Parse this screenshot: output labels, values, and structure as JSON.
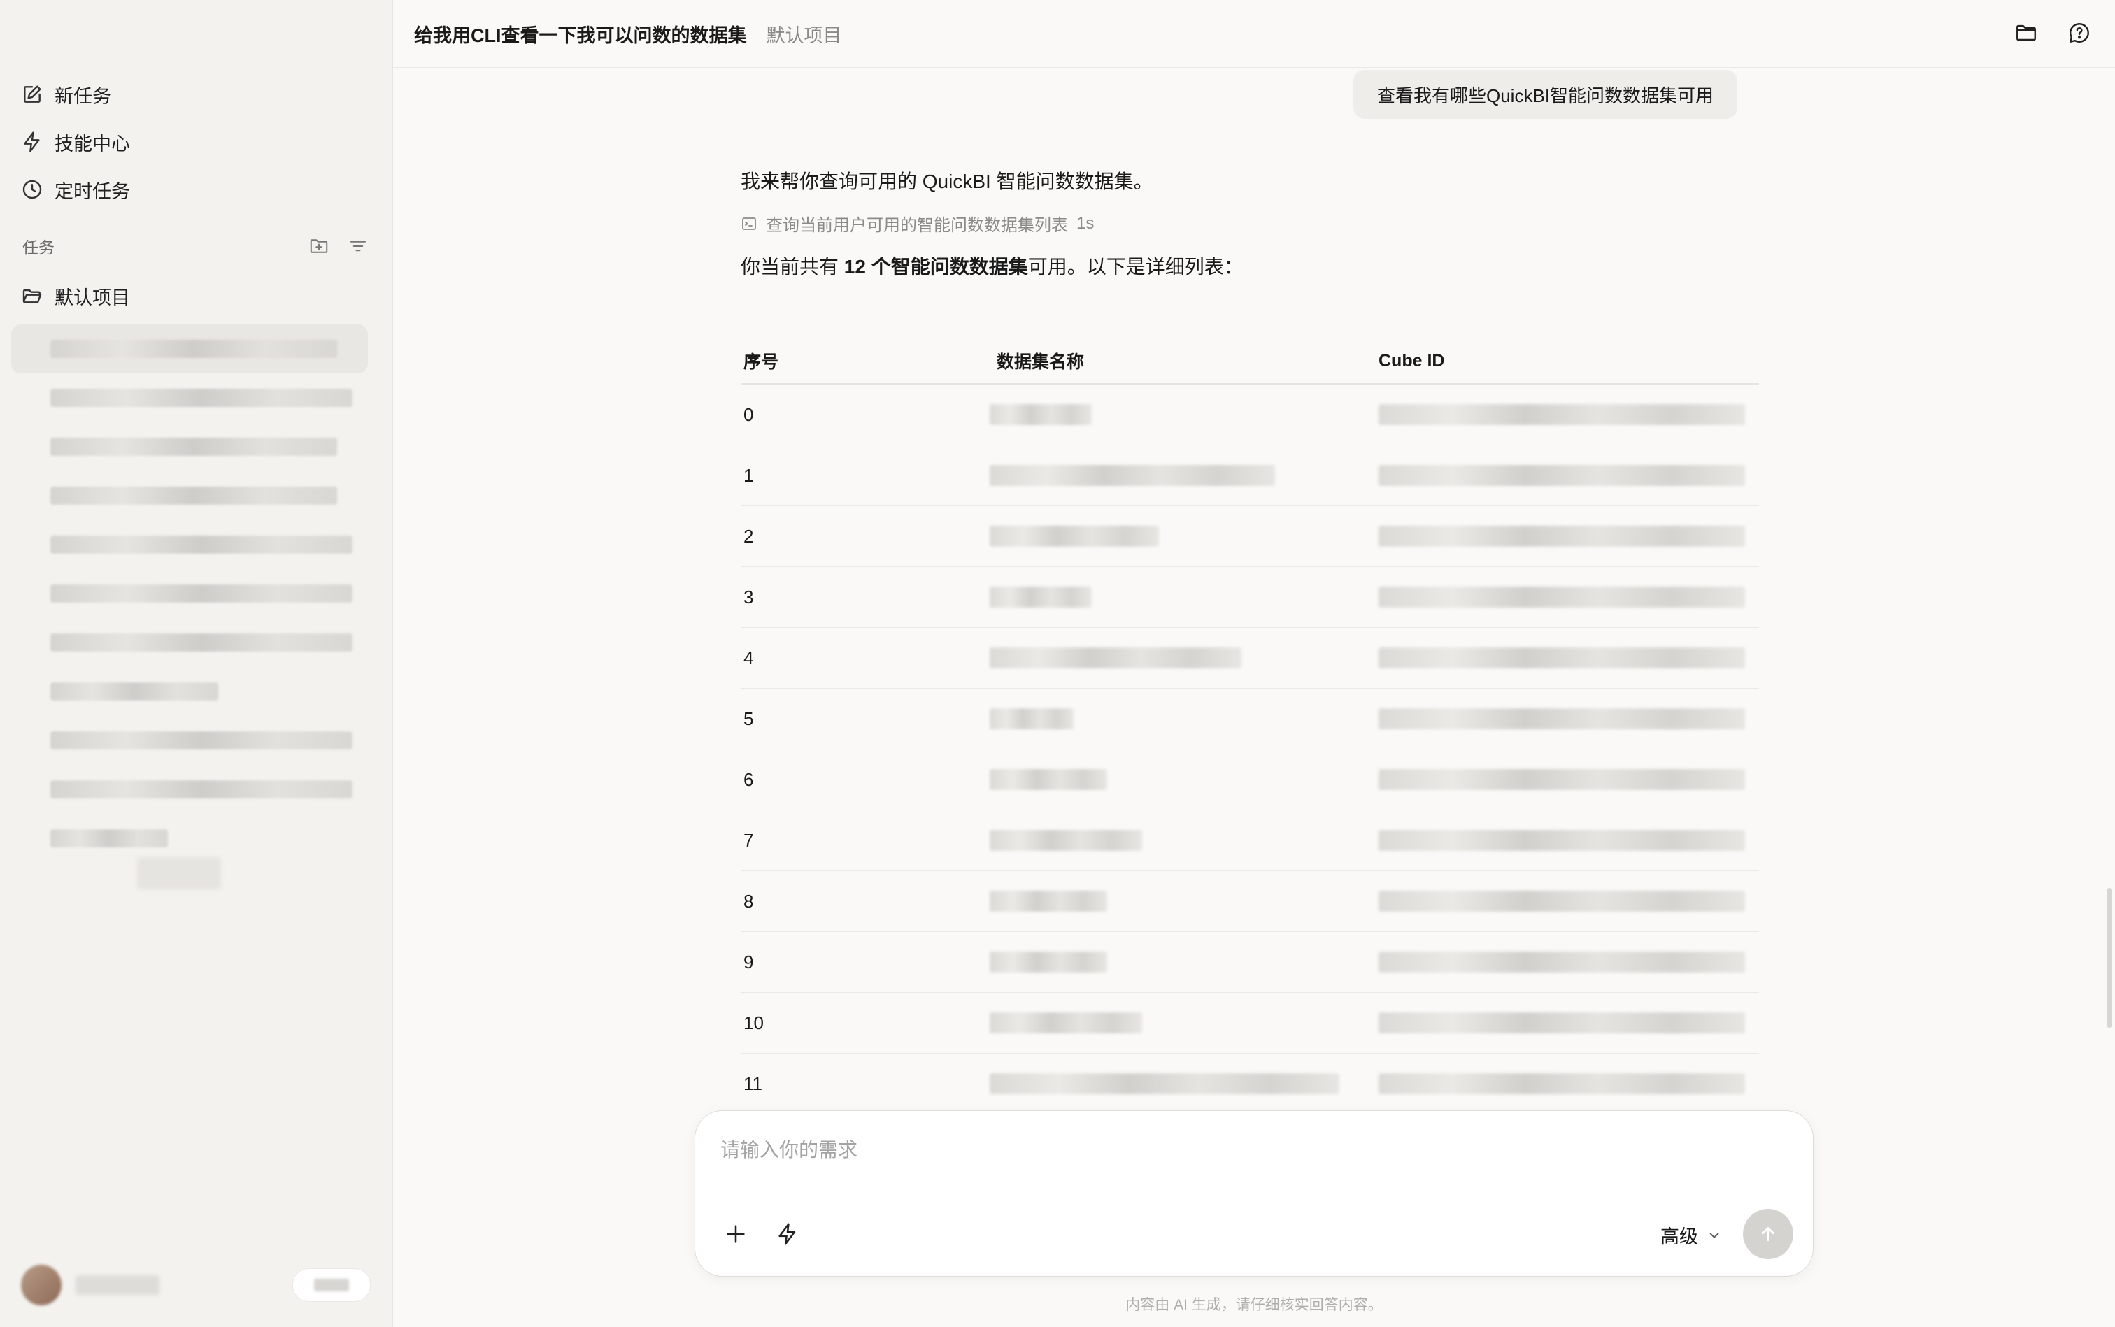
{
  "sidebar": {
    "nav": [
      {
        "label": "新任务",
        "icon": "edit-icon"
      },
      {
        "label": "技能中心",
        "icon": "lightning-icon"
      },
      {
        "label": "定时任务",
        "icon": "clock-icon"
      }
    ],
    "section_label": "任务",
    "project_label": "默认项目"
  },
  "header": {
    "title": "给我用CLI查看一下我可以问数的数据集",
    "breadcrumb": "默认项目"
  },
  "conversation": {
    "user_message": "查看我有哪些QuickBI智能问数数据集可用",
    "intro": "我来帮你查询可用的 QuickBI 智能问数数据集。",
    "tool_call": {
      "label": "查询当前用户可用的智能问数数据集列表",
      "duration": "1s"
    },
    "summary": {
      "prefix": "你当前共有 ",
      "highlight": "12 个智能问数数据集",
      "suffix": "可用。以下是详细列表："
    },
    "table": {
      "headers": [
        "序号",
        "数据集名称",
        "Cube ID"
      ],
      "rows": [
        {
          "index": "0"
        },
        {
          "index": "1"
        },
        {
          "index": "2"
        },
        {
          "index": "3"
        },
        {
          "index": "4"
        },
        {
          "index": "5"
        },
        {
          "index": "6"
        },
        {
          "index": "7"
        },
        {
          "index": "8"
        },
        {
          "index": "9"
        },
        {
          "index": "10"
        },
        {
          "index": "11"
        }
      ]
    }
  },
  "composer": {
    "placeholder": "请输入你的需求",
    "mode_label": "高级"
  },
  "disclaimer": "内容由 AI 生成，请仔细核实回答内容。"
}
